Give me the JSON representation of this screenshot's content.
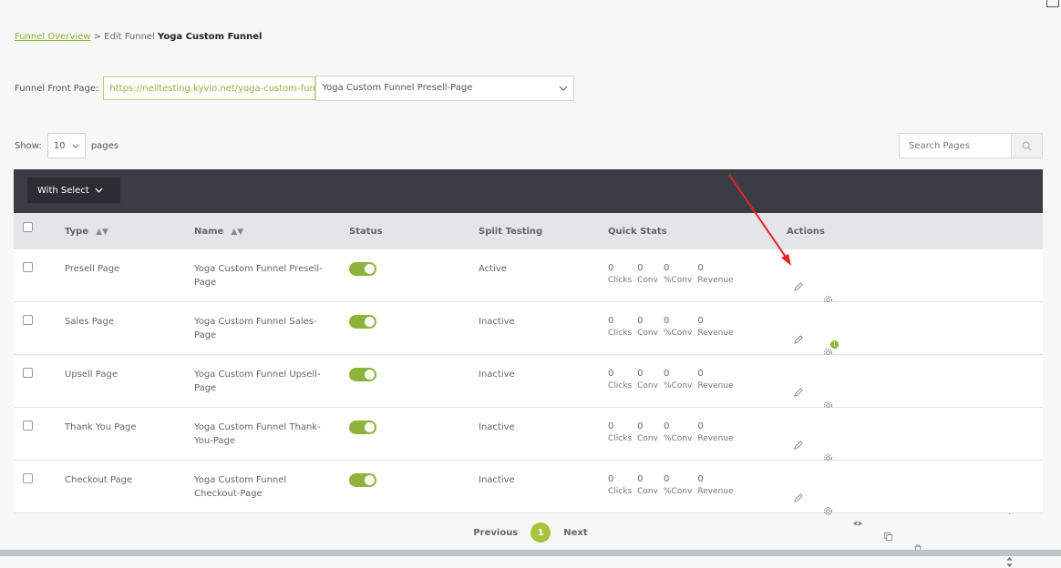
{
  "breadcrumb": {
    "link": "Funnel Overview",
    "sep": " > Edit Funnel ",
    "current": "Yoga Custom Funnel"
  },
  "front_page": {
    "label": "Funnel Front Page:",
    "url": "https://neiltesting.kyvio.net/yoga-custom-funnel",
    "selected": "Yoga Custom Funnel Presell-Page"
  },
  "show": {
    "label": "Show:",
    "value": "10",
    "suffix": "pages"
  },
  "search": {
    "placeholder": "Search Pages"
  },
  "toolbar": {
    "with_select": "With Select"
  },
  "columns": {
    "type": "Type",
    "name": "Name",
    "status": "Status",
    "split": "Split Testing",
    "stats": "Quick Stats",
    "actions": "Actions"
  },
  "stat_labels": {
    "clicks": "Clicks",
    "conv": "Conv",
    "pconv": "%Conv",
    "revenue": "Revenue"
  },
  "rows": [
    {
      "type": "Presell Page",
      "name": "Yoga Custom Funnel Presell-Page",
      "status_on": true,
      "split": "Active",
      "clicks": "0",
      "conv": "0",
      "pconv": "0",
      "revenue": "0"
    },
    {
      "type": "Sales Page",
      "name": "Yoga Custom Funnel Sales-Page",
      "status_on": true,
      "split": "Inactive",
      "clicks": "0",
      "conv": "0",
      "pconv": "0",
      "revenue": "0",
      "settings_badge": "1"
    },
    {
      "type": "Upsell Page",
      "name": "Yoga Custom Funnel Upsell-Page",
      "status_on": true,
      "split": "Inactive",
      "clicks": "0",
      "conv": "0",
      "pconv": "0",
      "revenue": "0"
    },
    {
      "type": "Thank You Page",
      "name": "Yoga Custom Funnel Thank-You-Page",
      "status_on": true,
      "split": "Inactive",
      "clicks": "0",
      "conv": "0",
      "pconv": "0",
      "revenue": "0"
    },
    {
      "type": "Checkout Page",
      "name": "Yoga Custom Funnel Checkout-Page",
      "status_on": true,
      "split": "Inactive",
      "clicks": "0",
      "conv": "0",
      "pconv": "0",
      "revenue": "0"
    }
  ],
  "pagination": {
    "previous": "Previous",
    "current": "1",
    "next": "Next"
  },
  "colors": {
    "accent": "#8cb33a",
    "toolbar": "#3b3d45",
    "annotation_arrow": "#e8231f"
  },
  "icons": [
    "edit-icon",
    "settings-gear-icon",
    "preview-eye-icon",
    "duplicate-icon",
    "trash-icon",
    "reorder-icon",
    "search-icon",
    "chevron-down-icon"
  ]
}
